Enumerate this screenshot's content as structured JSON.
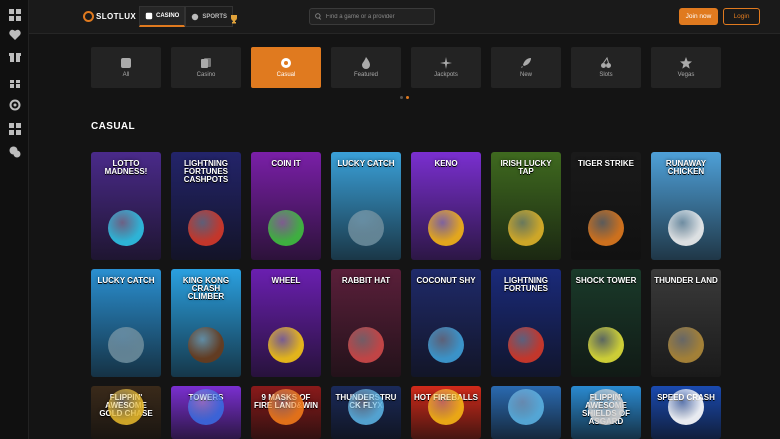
{
  "brand": {
    "name": "SLOTLUX",
    "accent": "#e07a1f"
  },
  "nav": {
    "casino_label": "CASINO",
    "sports_label": "SPORTS"
  },
  "search": {
    "placeholder": "Find a game or a provider"
  },
  "auth": {
    "join_label": "Join now",
    "login_label": "Login"
  },
  "sidebar": {
    "icons": [
      "grid-icon",
      "heart-icon",
      "gift-icon",
      "gift-box-icon",
      "target-icon",
      "grid-icon",
      "chat-icon"
    ]
  },
  "categories": [
    {
      "label": "All",
      "icon": "dice-icon"
    },
    {
      "label": "Casino",
      "icon": "cards-icon"
    },
    {
      "label": "Casual",
      "icon": "ball-icon",
      "active": true
    },
    {
      "label": "Featured",
      "icon": "fire-icon"
    },
    {
      "label": "Jackpots",
      "icon": "sparkle-icon"
    },
    {
      "label": "New",
      "icon": "rocket-icon"
    },
    {
      "label": "Slots",
      "icon": "cherry-icon"
    },
    {
      "label": "Vegas",
      "icon": "star-icon"
    }
  ],
  "section": {
    "title": "CASUAL"
  },
  "games": [
    {
      "title": "Lotto Madness!",
      "bg": "#4a2a8a",
      "art": "#2ec4e6"
    },
    {
      "title": "Lightning Fortunes Cashpots",
      "bg": "#23246a",
      "art": "#d63a2a"
    },
    {
      "title": "Coin It",
      "bg": "#7a1fa8",
      "art": "#3fbf3f"
    },
    {
      "title": "Lucky Catch",
      "bg": "#3aa0d8",
      "art": "#6a8a9a"
    },
    {
      "title": "Keno",
      "bg": "#7a2fd0",
      "art": "#f5b516"
    },
    {
      "title": "Irish Lucky Tap",
      "bg": "#3f6a1f",
      "art": "#e0b32a"
    },
    {
      "title": "Tiger Strike",
      "bg": "#1a1a1a",
      "art": "#e07a1f"
    },
    {
      "title": "Runaway Chicken",
      "bg": "#4ea0d8",
      "art": "#f0f0f0"
    },
    {
      "title": "Lucky Catch",
      "bg": "#2a8fd0",
      "art": "#6a8a9a"
    },
    {
      "title": "King Kong Crash Climber",
      "bg": "#2aa0e0",
      "art": "#6a3a1a"
    },
    {
      "title": "Wheel",
      "bg": "#6a1fb0",
      "art": "#f5c516"
    },
    {
      "title": "Rabbit Hat",
      "bg": "#5a1f3a",
      "art": "#d04a4a"
    },
    {
      "title": "Coconut Shy",
      "bg": "#1f2a6a",
      "art": "#3fa0d8"
    },
    {
      "title": "Lightning Fortunes",
      "bg": "#1a2a7a",
      "art": "#d63a2a"
    },
    {
      "title": "Shock Tower",
      "bg": "#1a3a2a",
      "art": "#e0e03a"
    },
    {
      "title": "Thunder Land",
      "bg": "#3a3a3a",
      "art": "#b08a3a"
    },
    {
      "title": "Flippin' Awesome Gold Chase",
      "bg": "#3a2a1a",
      "art": "#e0b32a"
    },
    {
      "title": "Towers",
      "bg": "#7a2fd0",
      "art": "#3a6ae0"
    },
    {
      "title": "9 Masks of Fire Land&Win",
      "bg": "#8a1a1a",
      "art": "#f07a1a"
    },
    {
      "title": "Thunderstruck FlyX",
      "bg": "#1a2a5a",
      "art": "#5ab0e0"
    },
    {
      "title": "Hot Fireballs",
      "bg": "#d02a1a",
      "art": "#f5b516"
    },
    {
      "title": "",
      "bg": "#2a6ab0",
      "art": "#5ab0e0"
    },
    {
      "title": "Flippin' Awesome Shields of Asgard",
      "bg": "#2a8ad0",
      "art": "#d0d0d0"
    },
    {
      "title": "Speed Crash",
      "bg": "#1a4ab0",
      "art": "#ffffff"
    }
  ]
}
